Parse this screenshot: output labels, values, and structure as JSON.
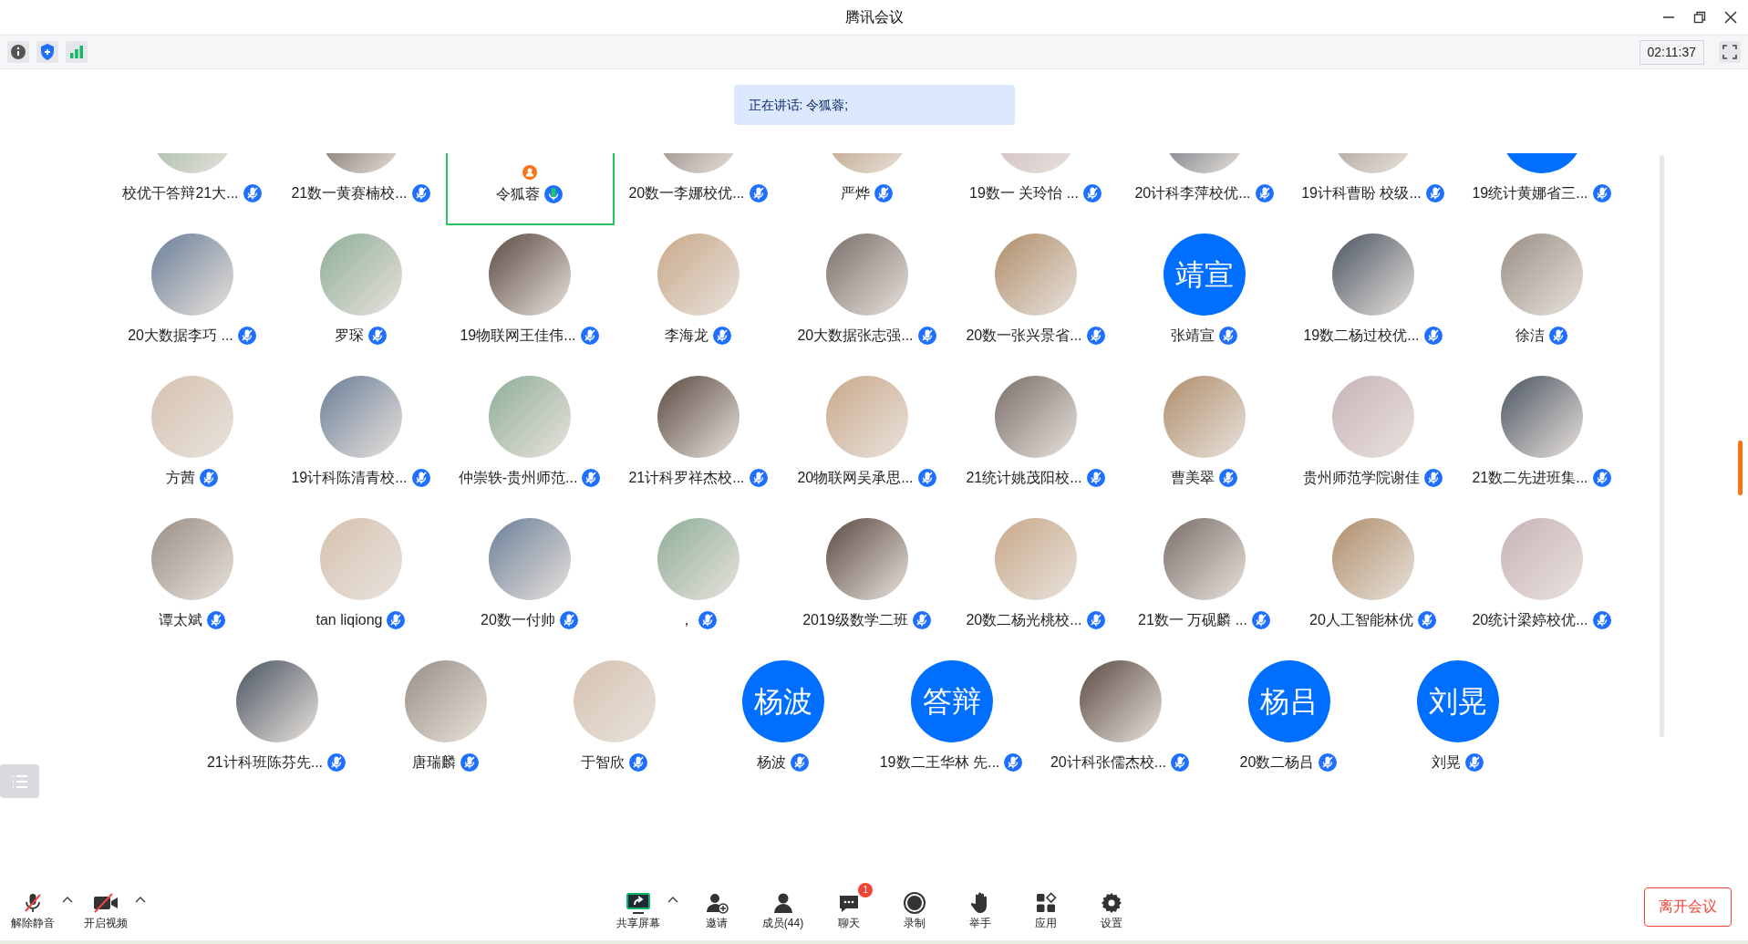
{
  "window": {
    "title": "腾讯会议"
  },
  "top_bar": {
    "timer": "02:11:37"
  },
  "banner": {
    "text": "正在讲话: 令狐蓉;"
  },
  "grid": {
    "rows": [
      [
        {
          "name": "校优干答辩21大...",
          "avatar": {
            "kind": "photo"
          },
          "speaking": false,
          "mic_on": false
        },
        {
          "name": "21数一黄赛楠校...",
          "avatar": {
            "kind": "photo"
          },
          "speaking": false,
          "mic_on": false
        },
        {
          "name": "令狐蓉",
          "speaking": true,
          "mic_on": true
        },
        {
          "name": "20数一李娜校优...",
          "avatar": {
            "kind": "photo"
          },
          "speaking": false,
          "mic_on": false
        },
        {
          "name": "严烨",
          "avatar": {
            "kind": "photo"
          },
          "speaking": false,
          "mic_on": false
        },
        {
          "name": "19数一 关玲怡 ...",
          "avatar": {
            "kind": "photo"
          },
          "speaking": false,
          "mic_on": false
        },
        {
          "name": "20计科李萍校优...",
          "avatar": {
            "kind": "photo"
          },
          "speaking": false,
          "mic_on": false
        },
        {
          "name": "19计科曹盼 校级...",
          "avatar": {
            "kind": "photo"
          },
          "speaking": false,
          "mic_on": false
        },
        {
          "name": "19统计黄娜省三...",
          "avatar": {
            "kind": "text"
          },
          "speaking": false,
          "mic_on": false
        }
      ],
      [
        {
          "name": "20大数据李巧  ...",
          "avatar": {
            "kind": "photo"
          },
          "speaking": false,
          "mic_on": false
        },
        {
          "name": "罗琛",
          "avatar": {
            "kind": "photo"
          },
          "speaking": false,
          "mic_on": false
        },
        {
          "name": "19物联网王佳伟...",
          "avatar": {
            "kind": "photo"
          },
          "speaking": false,
          "mic_on": false
        },
        {
          "name": "李海龙",
          "avatar": {
            "kind": "photo"
          },
          "speaking": false,
          "mic_on": false
        },
        {
          "name": "20大数据张志强...",
          "avatar": {
            "kind": "photo"
          },
          "speaking": false,
          "mic_on": false
        },
        {
          "name": "20数一张兴景省...",
          "avatar": {
            "kind": "photo"
          },
          "speaking": false,
          "mic_on": false
        },
        {
          "name": "张靖宣",
          "avatar": {
            "kind": "text",
            "text": "靖宣"
          },
          "speaking": false,
          "mic_on": false
        },
        {
          "name": "19数二杨过校优...",
          "avatar": {
            "kind": "photo"
          },
          "speaking": false,
          "mic_on": false
        },
        {
          "name": "徐洁",
          "avatar": {
            "kind": "photo"
          },
          "speaking": false,
          "mic_on": false
        }
      ],
      [
        {
          "name": "方茜",
          "avatar": {
            "kind": "photo"
          },
          "speaking": false,
          "mic_on": false
        },
        {
          "name": "19计科陈清青校...",
          "avatar": {
            "kind": "photo"
          },
          "speaking": false,
          "mic_on": false
        },
        {
          "name": "仲崇轶-贵州师范...",
          "avatar": {
            "kind": "photo"
          },
          "speaking": false,
          "mic_on": false
        },
        {
          "name": "21计科罗祥杰校...",
          "avatar": {
            "kind": "photo"
          },
          "speaking": false,
          "mic_on": false
        },
        {
          "name": "20物联网吴承思...",
          "avatar": {
            "kind": "photo"
          },
          "speaking": false,
          "mic_on": false
        },
        {
          "name": "21统计姚茂阳校...",
          "avatar": {
            "kind": "photo"
          },
          "speaking": false,
          "mic_on": false
        },
        {
          "name": "曹美翠",
          "avatar": {
            "kind": "photo"
          },
          "speaking": false,
          "mic_on": false
        },
        {
          "name": "贵州师范学院谢佳",
          "avatar": {
            "kind": "photo"
          },
          "speaking": false,
          "mic_on": false
        },
        {
          "name": "21数二先进班集...",
          "avatar": {
            "kind": "photo"
          },
          "speaking": false,
          "mic_on": false
        }
      ],
      [
        {
          "name": "谭太斌",
          "avatar": {
            "kind": "photo"
          },
          "speaking": false,
          "mic_on": false
        },
        {
          "name": "tan liqiong",
          "avatar": {
            "kind": "photo"
          },
          "speaking": false,
          "mic_on": false
        },
        {
          "name": "20数一付帅",
          "avatar": {
            "kind": "photo"
          },
          "speaking": false,
          "mic_on": false
        },
        {
          "name": "，",
          "avatar": {
            "kind": "photo"
          },
          "speaking": false,
          "mic_on": false
        },
        {
          "name": "2019级数学二班",
          "avatar": {
            "kind": "photo"
          },
          "speaking": false,
          "mic_on": false
        },
        {
          "name": "20数二杨光桃校...",
          "avatar": {
            "kind": "photo"
          },
          "speaking": false,
          "mic_on": false
        },
        {
          "name": "21数一 万砚麟 ...",
          "avatar": {
            "kind": "photo"
          },
          "speaking": false,
          "mic_on": false
        },
        {
          "name": "20人工智能林优",
          "avatar": {
            "kind": "photo"
          },
          "speaking": false,
          "mic_on": false
        },
        {
          "name": "20统计梁婷校优...",
          "avatar": {
            "kind": "photo"
          },
          "speaking": false,
          "mic_on": false
        }
      ],
      [
        {
          "name": "21计科班陈芬先...",
          "avatar": {
            "kind": "photo"
          },
          "speaking": false,
          "mic_on": false
        },
        {
          "name": "唐瑞麟",
          "avatar": {
            "kind": "photo"
          },
          "speaking": false,
          "mic_on": false
        },
        {
          "name": "于智欣",
          "avatar": {
            "kind": "photo"
          },
          "speaking": false,
          "mic_on": false
        },
        {
          "name": "杨波",
          "avatar": {
            "kind": "text",
            "text": "杨波"
          },
          "speaking": false,
          "mic_on": false
        },
        {
          "name": "19数二王华林 先...",
          "avatar": {
            "kind": "text",
            "text": "答辩"
          },
          "speaking": false,
          "mic_on": false
        },
        {
          "name": "20计科张儒杰校...",
          "avatar": {
            "kind": "photo"
          },
          "speaking": false,
          "mic_on": false
        },
        {
          "name": "20数二杨吕",
          "avatar": {
            "kind": "text",
            "text": "杨吕"
          },
          "speaking": false,
          "mic_on": false
        },
        {
          "name": "刘晃",
          "avatar": {
            "kind": "text",
            "text": "刘晃"
          },
          "speaking": false,
          "mic_on": false
        }
      ]
    ]
  },
  "toolbar": {
    "left": [
      {
        "kind": "mic",
        "label": "解除静音",
        "has_menu": true
      },
      {
        "kind": "video",
        "label": "开启视频",
        "has_menu": true
      }
    ],
    "center": [
      {
        "kind": "share",
        "label": "共享屏幕",
        "has_menu": true
      },
      {
        "kind": "invite",
        "label": "邀请",
        "has_menu": false
      },
      {
        "kind": "members",
        "label": "成员(44)",
        "has_menu": false
      },
      {
        "kind": "chat",
        "label": "聊天",
        "has_menu": false,
        "badge": "1"
      },
      {
        "kind": "record",
        "label": "录制",
        "has_menu": false
      },
      {
        "kind": "hand",
        "label": "举手",
        "has_menu": false
      },
      {
        "kind": "apps",
        "label": "应用",
        "has_menu": false
      },
      {
        "kind": "settings",
        "label": "设置",
        "has_menu": false
      }
    ],
    "leave": "离开会议"
  }
}
